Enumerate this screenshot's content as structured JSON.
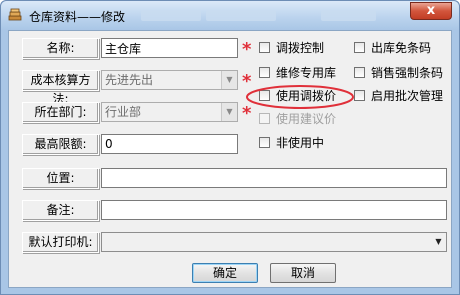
{
  "window": {
    "title": "仓库资料——修改",
    "close_label": "x"
  },
  "form": {
    "name_label": "名称:",
    "name_value": "主仓库",
    "cost_method_label": "成本核算方法:",
    "cost_method_value": "先进先出",
    "department_label": "所在部门:",
    "department_value": "行业部",
    "max_limit_label": "最高限额:",
    "max_limit_value": "0",
    "location_label": "位置:",
    "location_value": "",
    "remarks_label": "备注:",
    "remarks_value": "",
    "default_printer_label": "默认打印机:",
    "default_printer_value": "",
    "required_mark": "*"
  },
  "options": {
    "transfer_control": {
      "label": "调拨控制",
      "checked": false
    },
    "exempt_outbound_code": {
      "label": "出库免条码",
      "checked": false
    },
    "maintenance_warehouse": {
      "label": "维修专用库",
      "checked": false
    },
    "sales_force_barcode": {
      "label": "销售强制条码",
      "checked": false
    },
    "use_transfer_price": {
      "label": "使用调拨价",
      "checked": false
    },
    "enable_batch_management": {
      "label": "启用批次管理",
      "checked": false
    },
    "use_suggested_price": {
      "label": "使用建议价",
      "checked": false,
      "disabled": true
    },
    "not_in_use": {
      "label": "非使用中",
      "checked": false
    }
  },
  "buttons": {
    "ok_label": "确定",
    "cancel_label": "取消"
  },
  "colors": {
    "highlight_ellipse": "#e0303a",
    "required_mark": "#e0303a"
  }
}
